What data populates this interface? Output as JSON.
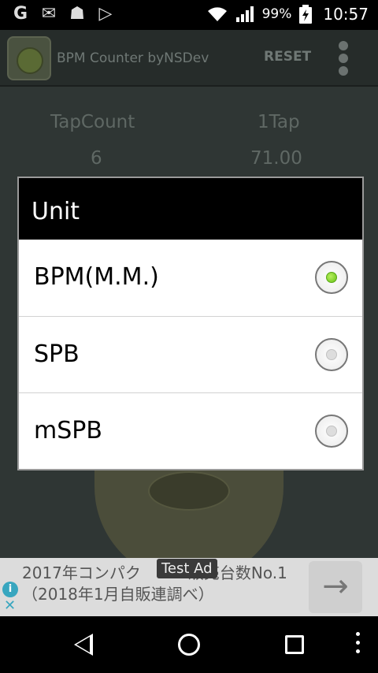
{
  "status_bar": {
    "icons": [
      "g-icon",
      "gmail-icon",
      "android-icon",
      "play-store-icon",
      "wifi-icon",
      "signal-icon",
      "battery-charging-icon"
    ],
    "battery": "99%",
    "time": "10:57"
  },
  "app": {
    "title": "BPM Counter byNSDev",
    "reset_label": "RESET",
    "tap_count_label": "TapCount",
    "tap_count_value": "6",
    "one_tap_label": "1Tap",
    "one_tap_value": "71.00"
  },
  "dialog": {
    "title": "Unit",
    "options": [
      {
        "label": "BPM(M.M.)",
        "selected": true
      },
      {
        "label": "SPB",
        "selected": false
      },
      {
        "label": "mSPB",
        "selected": false
      }
    ]
  },
  "ad": {
    "badge": "Test Ad",
    "text": "2017年コンパク　　　販売台数No.1（2018年1月自販連調べ）"
  },
  "colors": {
    "accent_radio": "#76c923",
    "dialog_title_bg": "#000000",
    "ad_info": "#38a6bf"
  }
}
